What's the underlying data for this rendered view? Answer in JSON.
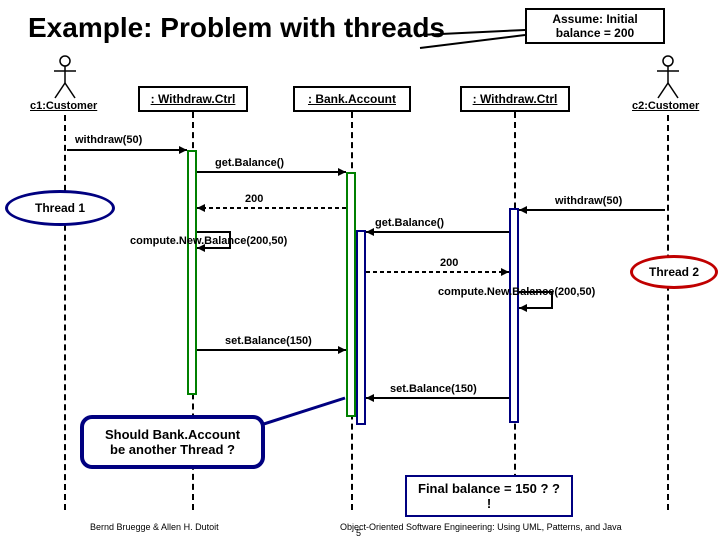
{
  "title": "Example: Problem with threads",
  "assume": "Assume: Initial balance = 200",
  "actors": {
    "left": "c1:Customer",
    "right": "c2:Customer"
  },
  "objects": {
    "wc1": ": Withdraw.Ctrl",
    "bank": ": Bank.Account",
    "wc2": ": Withdraw.Ctrl"
  },
  "messages": {
    "withdraw_left": "withdraw(50)",
    "getBalance_left": "get.Balance()",
    "ret200_left": "200",
    "compute_left": "compute.New.Balance(200,50)",
    "withdraw_right": "withdraw(50)",
    "getBalance_right": "get.Balance()",
    "ret200_right": "200",
    "compute_right": "compute.New.Balance(200,50)",
    "setBalance_left": "set.Balance(150)",
    "setBalance_right": "set.Balance(150)"
  },
  "threads": {
    "t1": "Thread 1",
    "t2": "Thread 2"
  },
  "callouts": {
    "question": "Should Bank.Account be another Thread ?",
    "final": "Final balance = 150 ? ? !"
  },
  "footer": {
    "left": "Bernd Bruegge & Allen H. Dutoit",
    "right": "Object-Oriented Software Engineering: Using UML, Patterns, and Java",
    "page": "5"
  }
}
